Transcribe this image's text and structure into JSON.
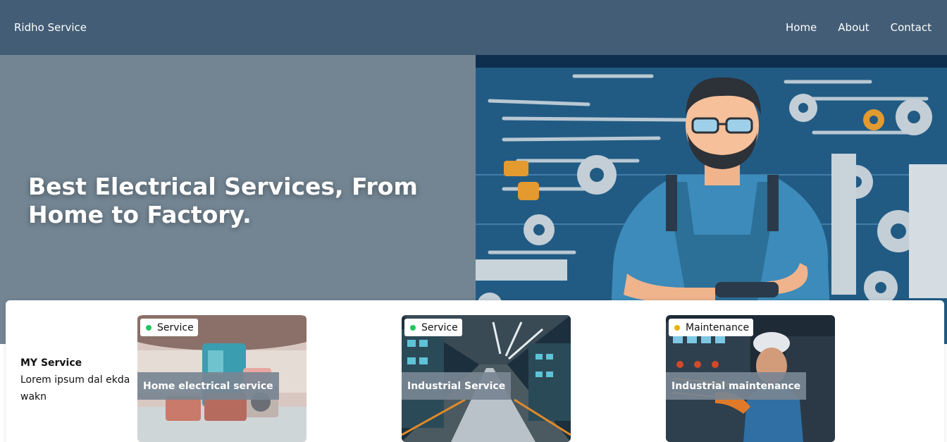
{
  "navbar": {
    "brand": "Ridho Service",
    "links": [
      {
        "label": "Home"
      },
      {
        "label": "About"
      },
      {
        "label": "Contact"
      }
    ],
    "background": "#425d75"
  },
  "hero": {
    "title": "Best Electrical Services, From Home to Factory.",
    "panel_color": "#738593"
  },
  "my_service": {
    "title": "MY Service",
    "description": "Lorem ipsum dal ekda wakn"
  },
  "cards": [
    {
      "badge": "Service",
      "badge_color": "#22c55e",
      "label": "Home electrical service"
    },
    {
      "badge": "Service",
      "badge_color": "#22c55e",
      "label": "Industrial Service"
    },
    {
      "badge": "Maintenance",
      "badge_color": "#eab308",
      "label": "Industrial maintenance"
    }
  ]
}
